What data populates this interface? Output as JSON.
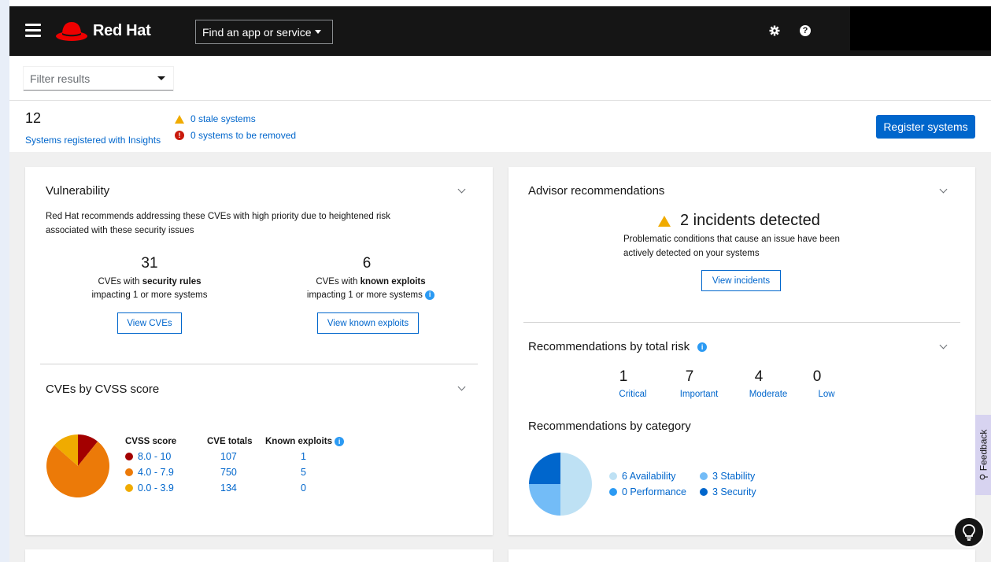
{
  "masthead": {
    "brand": "Red Hat",
    "app_selector": "Find an app or service",
    "icons": [
      "hamburger-icon",
      "gear-icon",
      "help-icon"
    ]
  },
  "filter": {
    "placeholder": "Filter results"
  },
  "summary": {
    "count": "12",
    "registered_label": "Systems registered with Insights",
    "stale": "0 stale systems",
    "to_be_removed": "0 systems to be removed",
    "register_button": "Register systems"
  },
  "vulnerability": {
    "title": "Vulnerability",
    "description": "Red Hat recommends addressing these CVEs with high priority due to heightened risk associated with these security issues",
    "security_rules": {
      "count": "31",
      "line1_prefix": "CVEs with ",
      "line1_bold": "security rules",
      "line2": "impacting 1 or more systems",
      "button": "View CVEs"
    },
    "known_exploits": {
      "count": "6",
      "line1_prefix": "CVEs with ",
      "line1_bold": "known exploits",
      "line2": "impacting 1 or more systems",
      "button": "View known exploits"
    }
  },
  "cvss": {
    "title": "CVEs by CVSS score",
    "headers": {
      "score": "CVSS score",
      "totals": "CVE totals",
      "exploits": "Known exploits"
    },
    "rows": [
      {
        "range": "8.0 - 10",
        "total": "107",
        "exploits": "1",
        "color": "#a30000"
      },
      {
        "range": "4.0 - 7.9",
        "total": "750",
        "exploits": "5",
        "color": "#ec7a08"
      },
      {
        "range": "0.0 - 3.9",
        "total": "134",
        "exploits": "0",
        "color": "#f0ab00"
      }
    ]
  },
  "advisor": {
    "title": "Advisor recommendations",
    "incidents": "2 incidents detected",
    "description": "Problematic conditions that cause an issue have been actively detected on your systems",
    "button": "View incidents"
  },
  "risk": {
    "title": "Recommendations by total risk",
    "items": [
      {
        "value": "1",
        "label": "Critical"
      },
      {
        "value": "7",
        "label": "Important"
      },
      {
        "value": "4",
        "label": "Moderate"
      },
      {
        "value": "0",
        "label": "Low"
      }
    ]
  },
  "category": {
    "title": "Recommendations by category",
    "items": [
      {
        "label": "6 Availability",
        "value": 6,
        "color": "#bee1f4"
      },
      {
        "label": "3 Stability",
        "value": 3,
        "color": "#73bcf7"
      },
      {
        "label": "0 Performance",
        "value": 0,
        "color": "#2b9af3"
      },
      {
        "label": "3 Security",
        "value": 3,
        "color": "#0066cc"
      }
    ]
  },
  "feedback": "Feedback"
}
